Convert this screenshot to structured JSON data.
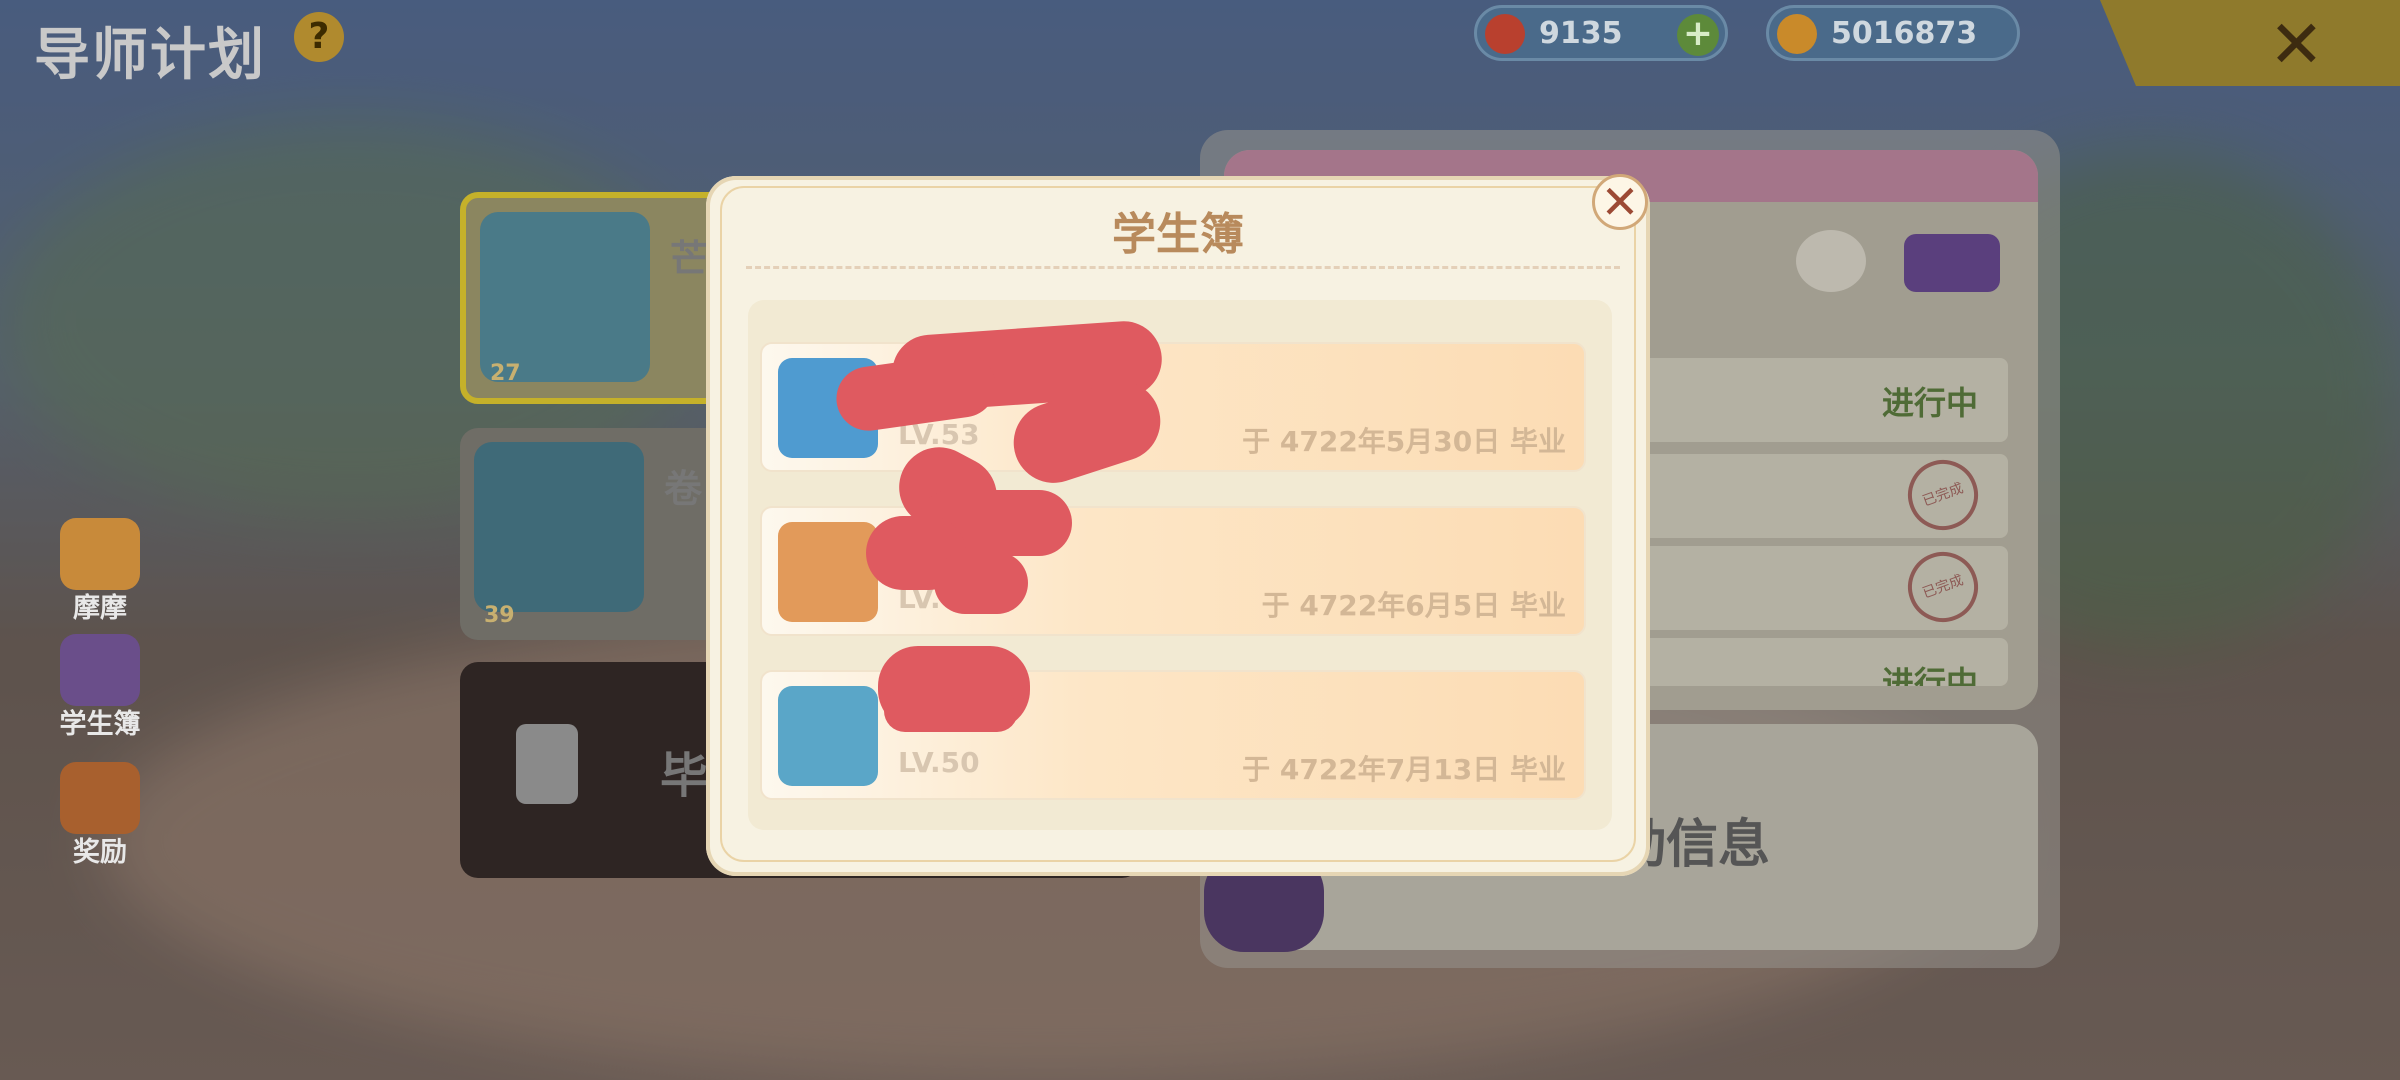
{
  "header": {
    "title": "导师计划",
    "help_label": "?",
    "currency_a": {
      "icon": "red-gem-icon",
      "value": "9135",
      "add_label": "+"
    },
    "currency_b": {
      "icon": "gold-bean-icon",
      "value": "5016873"
    },
    "close_label": "✕"
  },
  "sidebar": {
    "items": [
      {
        "label": "摩摩",
        "icon": "chat-icon"
      },
      {
        "label": "学生簿",
        "icon": "student-book-icon"
      },
      {
        "label": "奖励",
        "icon": "reward-bag-icon"
      }
    ]
  },
  "background": {
    "cards": [
      {
        "name": "芒",
        "level": "27"
      },
      {
        "name": "卷",
        "level": "39"
      },
      {
        "name": "毕"
      }
    ],
    "right_panel": {
      "rows": [
        {
          "text": "进行中"
        },
        {
          "stamp": "已完成"
        },
        {
          "stamp": "已完成"
        },
        {
          "text": "进行中"
        }
      ],
      "info_text": "动信息"
    }
  },
  "modal": {
    "title": "学生簿",
    "close_label": "✕",
    "students": [
      {
        "level": "LV.53",
        "graduation": "于 4722年5月30日 毕业"
      },
      {
        "level": "LV.",
        "graduation": "于 4722年6月5日 毕业"
      },
      {
        "level": "LV.50",
        "graduation": "于 4722年7月13日 毕业"
      }
    ]
  },
  "colors": {
    "modal_bg": "#f7f2e2",
    "modal_title": "#b88a5c",
    "redaction": "#df5a60",
    "status_green": "#4f6b36"
  }
}
